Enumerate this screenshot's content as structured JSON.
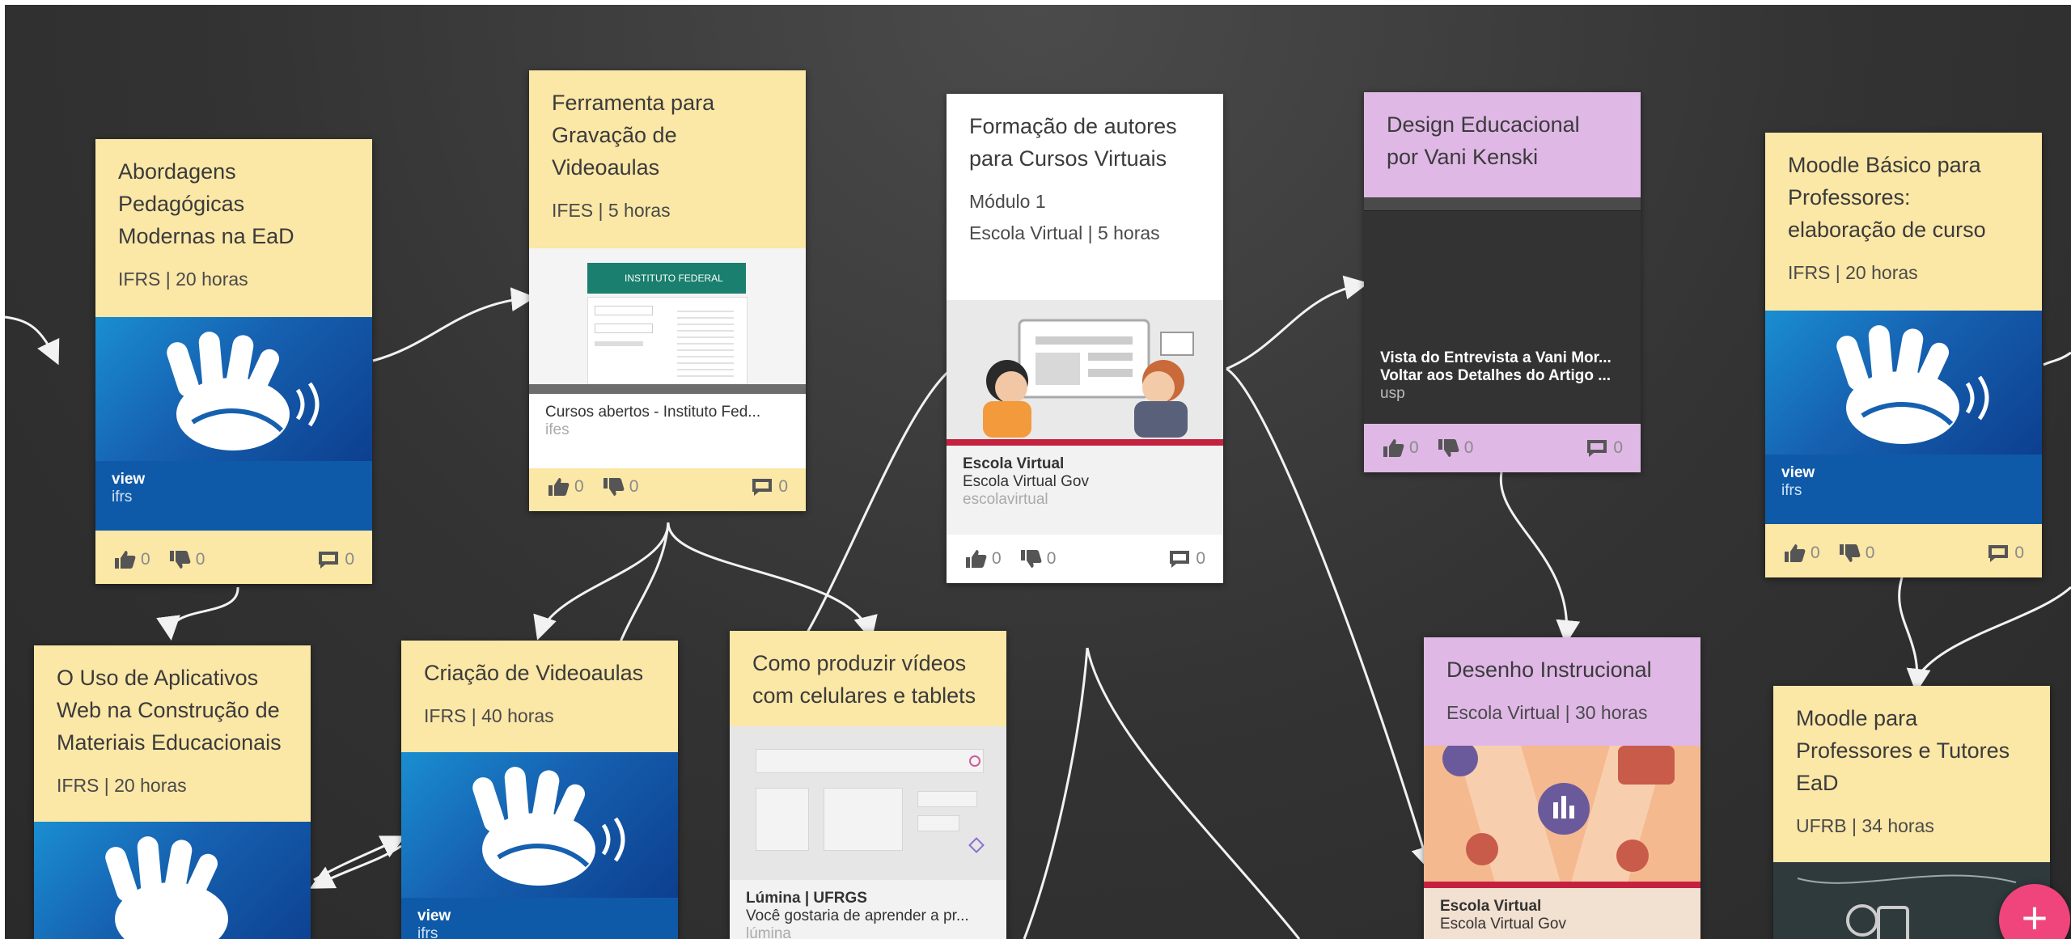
{
  "cards": {
    "abordagens": {
      "title_lines": [
        "Abordagens",
        "Pedagógicas",
        "Modernas na EaD"
      ],
      "meta": "IFRS | 20 horas",
      "link_title": "view",
      "link_source": "ifrs",
      "likes": "0",
      "dislikes": "0",
      "comments": "0"
    },
    "ferramenta": {
      "title_lines": [
        "Ferramenta para",
        "Gravação de",
        "Videoaulas"
      ],
      "meta": "IFES | 5 horas",
      "shot_header": "INSTITUTO FEDERAL",
      "link_title": "Cursos abertos - Instituto Fed...",
      "link_source": "ifes",
      "likes": "0",
      "dislikes": "0",
      "comments": "0"
    },
    "formacao": {
      "title_lines": [
        "Formação de autores",
        "para Cursos Virtuais"
      ],
      "meta1": "Módulo 1",
      "meta2": "Escola Virtual | 5 horas",
      "link_title": "Escola Virtual",
      "link_subtitle": "Escola Virtual Gov",
      "link_source": "escolavirtual",
      "likes": "0",
      "dislikes": "0",
      "comments": "0"
    },
    "design": {
      "title_lines": [
        "Design Educacional",
        "por Vani Kenski"
      ],
      "link_title": "Vista do Entrevista a Vani Mor...",
      "link_subtitle": "Voltar aos Detalhes do Artigo ...",
      "link_source": "usp",
      "likes": "0",
      "dislikes": "0",
      "comments": "0"
    },
    "moodle_basico": {
      "title_lines": [
        "Moodle Básico para",
        "Professores:",
        "elaboração de curso"
      ],
      "meta": "IFRS | 20 horas",
      "link_title": "view",
      "link_source": "ifrs",
      "likes": "0",
      "dislikes": "0",
      "comments": "0"
    },
    "uso_aplicativos": {
      "title_lines": [
        "O Uso de Aplicativos",
        "Web na Construção de",
        "Materiais Educacionais"
      ],
      "meta": "IFRS | 20 horas"
    },
    "criacao": {
      "title_lines": [
        "Criação de Videoaulas"
      ],
      "meta": "IFRS | 40 horas",
      "link_title": "view",
      "link_source": "ifrs"
    },
    "como_produzir": {
      "title_lines": [
        "Como produzir vídeos",
        "com celulares e tablets"
      ],
      "link_title": "Lúmina | UFRGS",
      "link_subtitle": "Você gostaria de aprender a pr...",
      "link_source": "lúmina"
    },
    "desenho": {
      "title_lines": [
        "Desenho Instrucional"
      ],
      "meta": "Escola Virtual | 30 horas",
      "link_title": "Escola Virtual",
      "link_subtitle": "Escola Virtual Gov"
    },
    "moodle_tutores": {
      "title_lines": [
        "Moodle para",
        "Professores e Tutores",
        "EaD"
      ],
      "meta": "UFRB | 34 horas"
    }
  },
  "fab": {
    "label": "+"
  },
  "colors": {
    "canvas": "#333333",
    "yellow": "#fbe7a6",
    "purple": "#dfb8e6",
    "white": "#ffffff",
    "accent": "#f0457c",
    "connector": "#f2f2f2"
  },
  "icons": [
    "sign-language-icon",
    "thumbs-up-icon",
    "thumbs-down-icon",
    "comment-icon",
    "plus-icon"
  ]
}
